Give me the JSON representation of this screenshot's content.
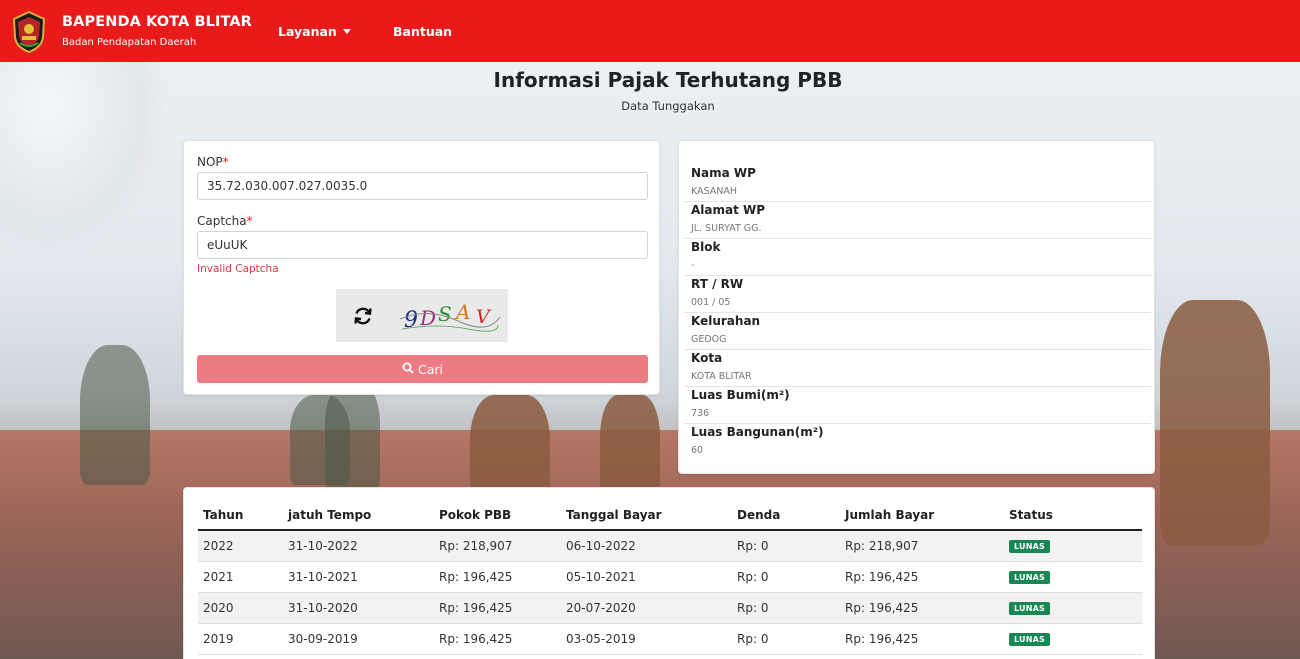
{
  "navbar": {
    "brand_title": "BAPENDA KOTA BLITAR",
    "brand_subtitle": "Badan Pendapatan Daerah",
    "menu_layanan": "Layanan",
    "menu_bantuan": "Bantuan"
  },
  "page": {
    "title": "Informasi Pajak Terhutang PBB",
    "subtitle": "Data Tunggakan"
  },
  "form": {
    "nop_label": "NOP",
    "nop_value": "35.72.030.007.027.0035.0",
    "captcha_label": "Captcha",
    "captcha_value": "eUuUK",
    "required_mark": "*",
    "error_message": "Invalid Captcha",
    "captcha_image_text": "9DSAV",
    "search_button": "Cari"
  },
  "info": {
    "rows": [
      {
        "label": "Nama WP",
        "value": "KASANAH"
      },
      {
        "label": "Alamat WP",
        "value": "JL. SURYAT GG."
      },
      {
        "label": "Blok",
        "value": "-"
      },
      {
        "label": "RT / RW",
        "value": "001 / 05"
      },
      {
        "label": "Kelurahan",
        "value": "GEDOG"
      },
      {
        "label": "Kota",
        "value": "KOTA BLITAR"
      },
      {
        "label": "Luas Bumi(m²)",
        "value": "736"
      },
      {
        "label": "Luas Bangunan(m²)",
        "value": "60"
      }
    ]
  },
  "table": {
    "headers": [
      "Tahun",
      "jatuh Tempo",
      "Pokok PBB",
      "Tanggal Bayar",
      "Denda",
      "Jumlah Bayar",
      "Status"
    ],
    "rows": [
      [
        "2022",
        "31-10-2022",
        "Rp: 218,907",
        "06-10-2022",
        "Rp: 0",
        "Rp: 218,907",
        "LUNAS"
      ],
      [
        "2021",
        "31-10-2021",
        "Rp: 196,425",
        "05-10-2021",
        "Rp: 0",
        "Rp: 196,425",
        "LUNAS"
      ],
      [
        "2020",
        "31-10-2020",
        "Rp: 196,425",
        "20-07-2020",
        "Rp: 0",
        "Rp: 196,425",
        "LUNAS"
      ],
      [
        "2019",
        "30-09-2019",
        "Rp: 196,425",
        "03-05-2019",
        "Rp: 0",
        "Rp: 196,425",
        "LUNAS"
      ]
    ]
  },
  "colors": {
    "navbar": "#e81a1a",
    "button": "#ee7a83",
    "badge": "#198754",
    "error": "#dc3545"
  },
  "icons": {
    "logo": "city-emblem-icon",
    "refresh": "refresh-icon",
    "search": "search-icon",
    "dropdown": "chevron-down-icon"
  }
}
